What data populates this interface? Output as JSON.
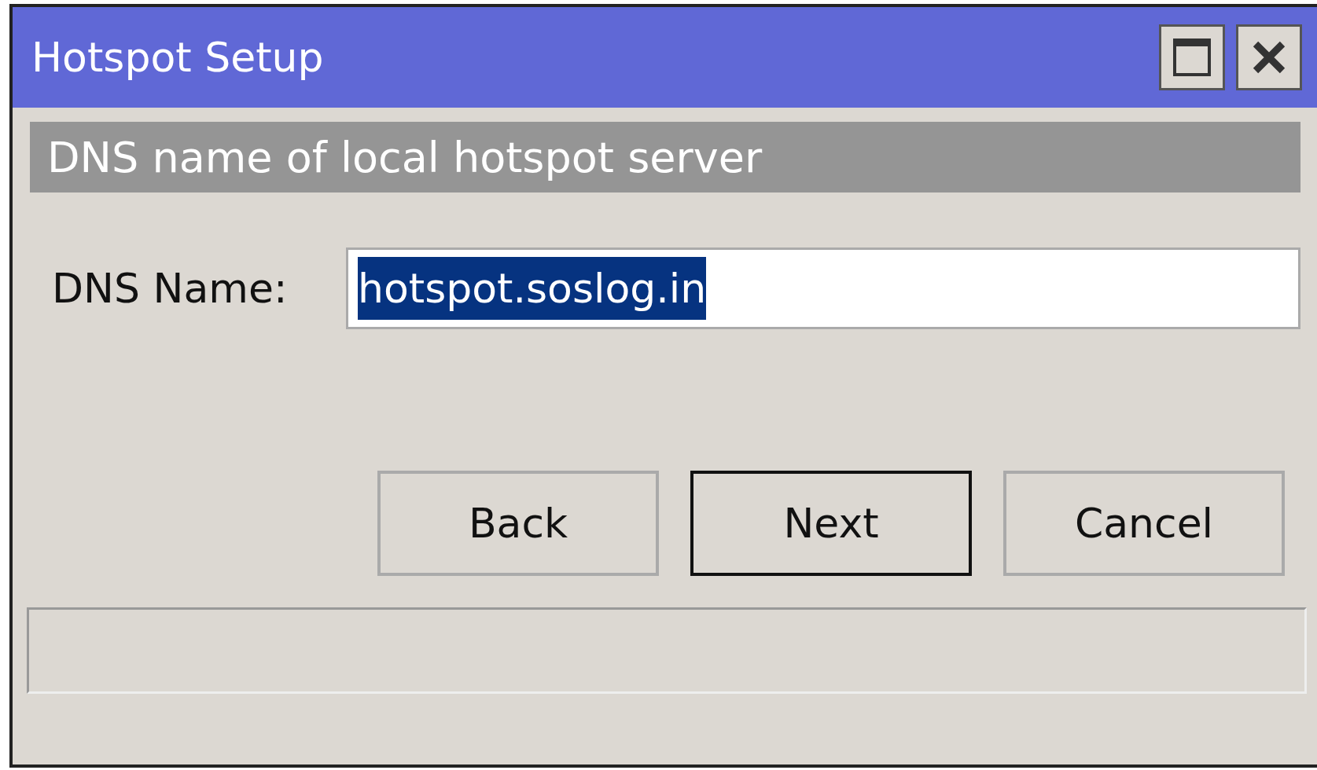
{
  "window": {
    "title": "Hotspot Setup"
  },
  "header": "DNS name of local hotspot server",
  "field": {
    "label": "DNS Name:",
    "value": "hotspot.soslog.in",
    "selected": true
  },
  "buttons": [
    {
      "label": "Back",
      "default": false
    },
    {
      "label": "Next",
      "default": true
    },
    {
      "label": "Cancel",
      "default": false
    }
  ]
}
